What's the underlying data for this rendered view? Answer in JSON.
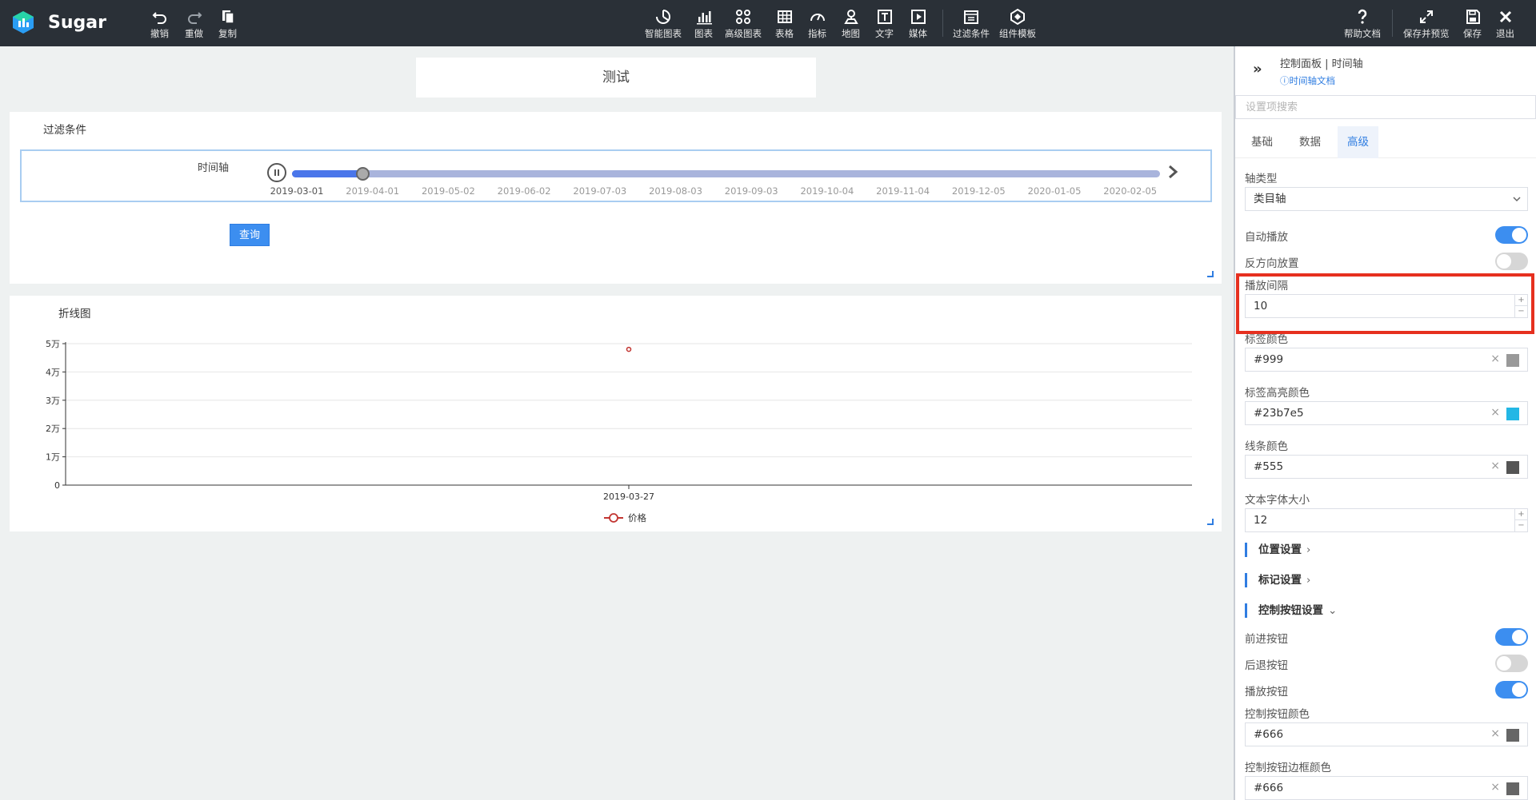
{
  "app": {
    "name": "Sugar"
  },
  "toolbar": {
    "left": [
      {
        "id": "undo",
        "label": "撤销",
        "icon": "undo-icon"
      },
      {
        "id": "redo",
        "label": "重做",
        "icon": "redo-icon"
      },
      {
        "id": "copy",
        "label": "复制",
        "icon": "copy-icon"
      }
    ],
    "center": [
      {
        "id": "smart-chart",
        "label": "智能图表",
        "icon": "smart-chart-icon"
      },
      {
        "id": "chart",
        "label": "图表",
        "icon": "bar-chart-icon"
      },
      {
        "id": "advanced-chart",
        "label": "高级图表",
        "icon": "advanced-chart-icon"
      },
      {
        "id": "table",
        "label": "表格",
        "icon": "table-icon"
      },
      {
        "id": "metric",
        "label": "指标",
        "icon": "gauge-icon"
      },
      {
        "id": "map",
        "label": "地图",
        "icon": "map-icon"
      },
      {
        "id": "text",
        "label": "文字",
        "icon": "text-icon"
      },
      {
        "id": "media",
        "label": "媒体",
        "icon": "media-icon"
      },
      {
        "id": "filter",
        "label": "过滤条件",
        "icon": "filter-icon"
      },
      {
        "id": "template",
        "label": "组件模板",
        "icon": "template-icon"
      }
    ],
    "right": [
      {
        "id": "help",
        "label": "帮助文档",
        "icon": "help-icon"
      },
      {
        "id": "save-preview",
        "label": "保存并预览",
        "icon": "expand-icon"
      },
      {
        "id": "save",
        "label": "保存",
        "icon": "save-icon"
      },
      {
        "id": "exit",
        "label": "退出",
        "icon": "close-icon"
      }
    ]
  },
  "page": {
    "title": "测试"
  },
  "filter_card": {
    "title": "过滤条件",
    "timeline_label": "时间轴",
    "play_state": "playing",
    "progress": 0.081,
    "ticks": [
      "2019-03-01",
      "2019-04-01",
      "2019-05-02",
      "2019-06-02",
      "2019-07-03",
      "2019-08-03",
      "2019-09-03",
      "2019-10-04",
      "2019-11-04",
      "2019-12-05",
      "2020-01-05",
      "2020-02-05"
    ],
    "active_tick": 0,
    "query_label": "查询"
  },
  "line_card": {
    "title": "折线图"
  },
  "chart_data": {
    "type": "line",
    "title": "折线图",
    "categories": [
      "2019-03-27"
    ],
    "series": [
      {
        "name": "价格",
        "values": [
          48000
        ],
        "color": "#c23531"
      }
    ],
    "y_ticks": [
      "0",
      "1万",
      "2万",
      "3万",
      "4万",
      "5万"
    ],
    "ylim": [
      0,
      50000
    ],
    "grid": true,
    "legend": "bottom-center"
  },
  "panel": {
    "header": "控制面板 | 时间轴",
    "doc_link": "时间轴文档",
    "search_placeholder": "设置项搜索",
    "tabs": [
      {
        "label": "基础",
        "active": false
      },
      {
        "label": "数据",
        "active": false
      },
      {
        "label": "高级",
        "active": true
      }
    ],
    "axis_type": {
      "label": "轴类型",
      "value": "类目轴"
    },
    "autoplay": {
      "label": "自动播放",
      "on": true
    },
    "reverse": {
      "label": "反方向放置",
      "on": false
    },
    "interval": {
      "label": "播放间隔",
      "value": "10"
    },
    "label_color": {
      "label": "标签颜色",
      "value": "#999"
    },
    "label_highlight_color": {
      "label": "标签高亮颜色",
      "value": "#23b7e5"
    },
    "line_color": {
      "label": "线条颜色",
      "value": "#555"
    },
    "font_size": {
      "label": "文本字体大小",
      "value": "12"
    },
    "position_section": "位置设置",
    "marker_section": "标记设置",
    "control_section": "控制按钮设置",
    "forward_btn": {
      "label": "前进按钮",
      "on": true
    },
    "backward_btn": {
      "label": "后退按钮",
      "on": false
    },
    "play_btn": {
      "label": "播放按钮",
      "on": true
    },
    "control_color": {
      "label": "控制按钮颜色",
      "value": "#666"
    },
    "control_border_color": {
      "label": "控制按钮边框颜色",
      "value": "#666"
    }
  }
}
